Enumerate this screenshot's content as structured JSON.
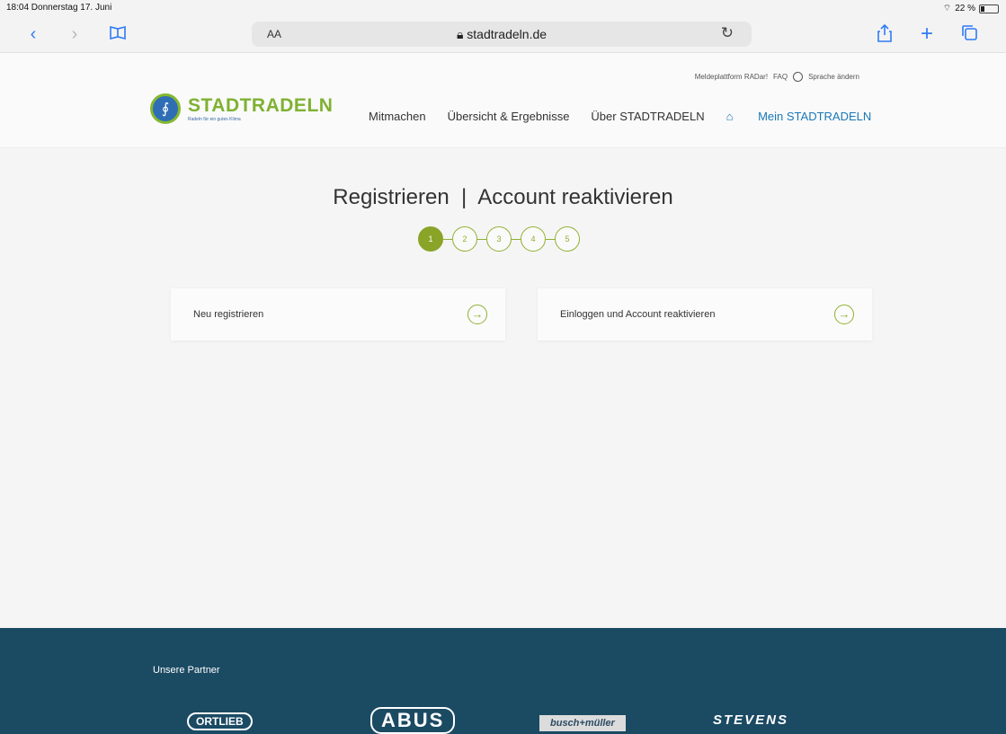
{
  "status_bar": {
    "time_date": "18:04  Donnerstag 17. Juni",
    "battery": "22 %"
  },
  "browser": {
    "text_size_label": "AA",
    "url": "stadtradeln.de"
  },
  "site": {
    "logo_title": "STADTRADELN",
    "logo_subtitle": "Radeln für ein gutes Klima",
    "top_links": [
      "Meldeplattform RADar!",
      "FAQ",
      "Sprache ändern"
    ],
    "main_nav": [
      "Mitmachen",
      "Übersicht & Ergebnisse",
      "Über STADTRADELN",
      "Mein STADTRADELN"
    ]
  },
  "page": {
    "heading": "Registrieren  |  Account reaktivieren",
    "steps": [
      "1",
      "2",
      "3",
      "4",
      "5"
    ],
    "active_step": 1,
    "options": [
      {
        "label": "Neu registrieren"
      },
      {
        "label": "Einloggen und Account reaktivieren"
      }
    ]
  },
  "footer": {
    "partners_title": "Unsere Partner",
    "partners": [
      "ORTLIEB",
      "ABUS",
      "busch+müller",
      "STEVENS"
    ]
  },
  "colors": {
    "brand_green": "#8fb02f",
    "link_blue": "#1a78b6",
    "footer_bg": "#1b4a63"
  }
}
